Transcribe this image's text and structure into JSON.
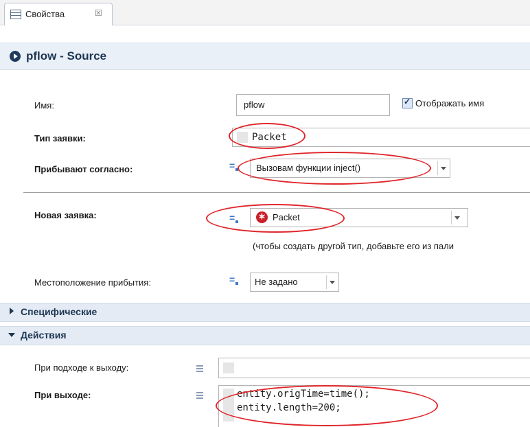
{
  "tab": {
    "label": "Свойства",
    "close": "☒"
  },
  "header": {
    "title": "pflow - Source",
    "icon": "play-circle-icon"
  },
  "props": {
    "name_label": "Имя:",
    "name_value": "pflow",
    "show_name_label": "Отображать имя",
    "show_name_checked": true,
    "entity_type_label": "Тип заявки:",
    "entity_type_value": "Packet",
    "arrivals_label": "Прибывают согласно:",
    "arrivals_value": "Вызовам функции inject()",
    "new_entity_label": "Новая заявка:",
    "new_entity_value": "Packet",
    "new_entity_hint": "(чтобы создать другой тип, добавьте его из пали",
    "location_label": "Местоположение прибытия:",
    "location_value": "Не задано"
  },
  "sections": {
    "specific": "Специфические",
    "actions": "Действия"
  },
  "actions": {
    "on_approach_label": "При подходе к выходу:",
    "on_exit_label": "При выходе:",
    "on_exit_code_line1": "entity.origTime=time();",
    "on_exit_code_line2": "entity.length=200;"
  },
  "colors": {
    "annotation": "#e0262b",
    "header_text": "#1c3553",
    "accent": "#3d78c7"
  }
}
